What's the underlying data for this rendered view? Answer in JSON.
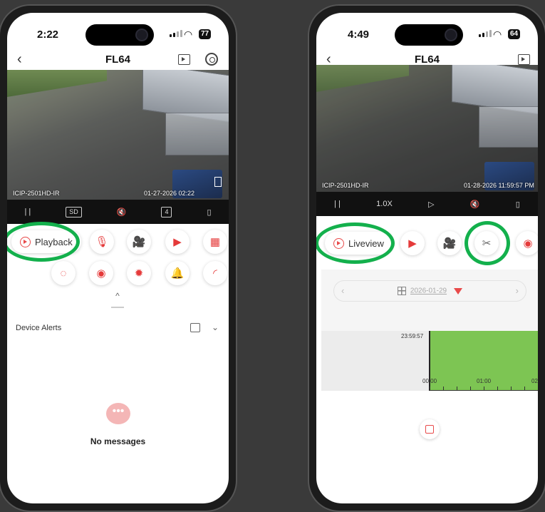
{
  "left_phone": {
    "status": {
      "time": "2:22",
      "battery": "77"
    },
    "nav": {
      "title": "FL64",
      "back_glyph": "‹"
    },
    "video": {
      "camera_label": "ICIP-2501HD-IR",
      "timestamp": "01-27-2026 02:22"
    },
    "controls": {
      "pause": "| |",
      "quality": "SD",
      "mute": "🔇",
      "channels": "4",
      "device": "▯"
    },
    "playback_button": {
      "label": "Playback"
    },
    "functions": [
      "microphone-icon",
      "camera-icon",
      "video-icon",
      "grid-icon",
      "motion-icon",
      "eye-icon",
      "light-icon",
      "bell-icon",
      "wiper-icon"
    ],
    "drawer_arrow": "^",
    "alerts": {
      "title": "Device Alerts",
      "chevron": "⌄"
    },
    "empty": {
      "bubble": "•••",
      "message": "No messages"
    }
  },
  "right_phone": {
    "status": {
      "time": "4:49",
      "battery": "64"
    },
    "nav": {
      "title": "FL64",
      "back_glyph": "‹"
    },
    "video": {
      "camera_label": "ICIP-2501HD-IR",
      "timestamp": "01-28-2026 11:59:57 PM"
    },
    "controls": {
      "pause": "| |",
      "speed": "1.0X",
      "play": "▷",
      "mute": "🔇",
      "device": "▯"
    },
    "liveview_button": {
      "label": "Liveview"
    },
    "functions": [
      "youtube-icon",
      "camera-icon",
      "scissors-icon",
      "eye-icon"
    ],
    "date_bar": {
      "prev": "‹",
      "date": "2026-01-29",
      "next": "›"
    },
    "timeline": {
      "cursor_time": "23:59:57",
      "ticks": [
        "00:00",
        "01:00",
        "02"
      ]
    }
  },
  "colors": {
    "accent_red": "#e84a4a",
    "highlight_green": "#13b04c",
    "timeline_green": "#7dc553"
  }
}
